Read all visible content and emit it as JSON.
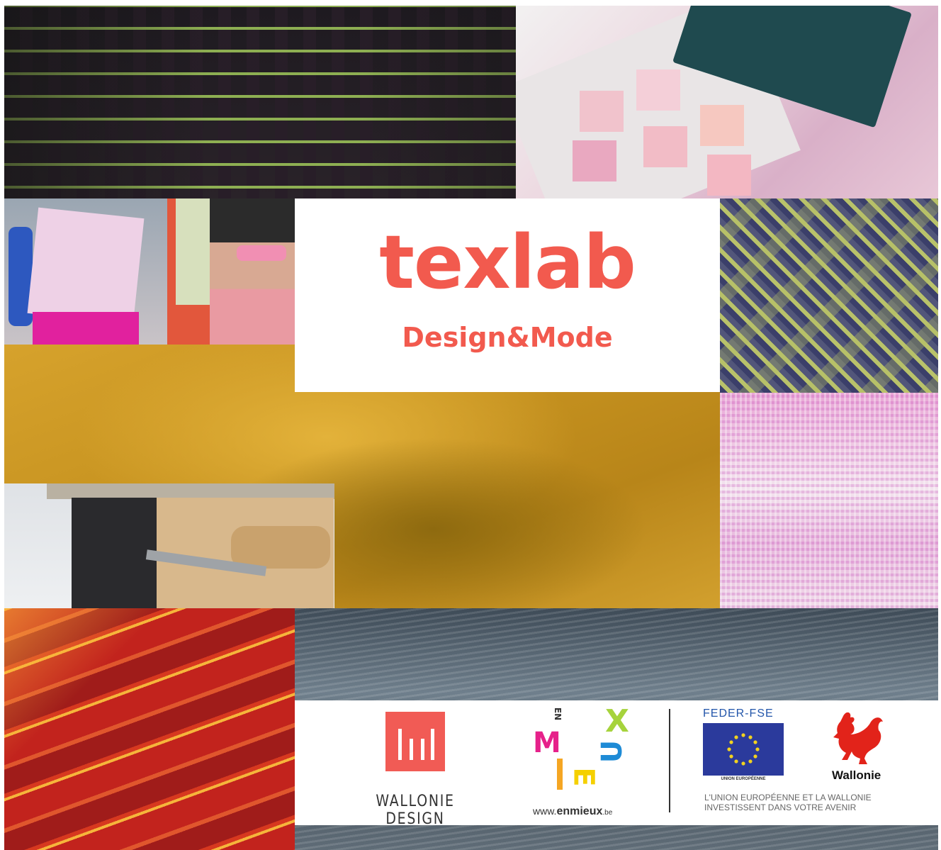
{
  "brand": {
    "name": "texlab",
    "tagline": "Design&Mode",
    "color": "#f25a4e"
  },
  "partners": {
    "wallonie_design": {
      "label": "WALLONIE DESIGN",
      "color": "#f15b55"
    },
    "enmieux": {
      "letters": {
        "m": "M",
        "en": "EN",
        "x": "X",
        "e": "E",
        "u": "U"
      },
      "url_prefix": "www.",
      "url_name": "enmieux",
      "url_suffix": ".be"
    },
    "feder": {
      "label": "FEDER-FSE",
      "flag_caption": "UNION EUROPÉENNE",
      "statement_line1": "L'UNION EUROPÉENNE ET LA WALLONIE",
      "statement_line2": "INVESTISSENT DANS VOTRE AVENIR",
      "flag_color": "#2b3a9c"
    },
    "wallonie": {
      "label": "Wallonie",
      "color": "#e2231a"
    }
  },
  "collage": {
    "tiles": [
      "embroidered-dark-fabric-photo",
      "pink-color-swatch-book-photo",
      "fashion-runway-photos",
      "herringbone-woven-fabric-photo",
      "mustard-draped-fabric-photo",
      "pink-woven-fabric-photo",
      "loom-workshop-photo",
      "red-leather-hides-photo",
      "denim-texture-photo"
    ]
  }
}
